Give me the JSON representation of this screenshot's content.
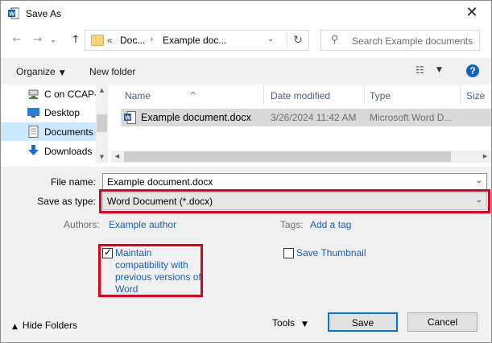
{
  "window": {
    "title": "Save As",
    "close_glyph": "✕"
  },
  "nav": {
    "back_glyph": "←",
    "forward_glyph": "→",
    "recent_glyph": "⌄",
    "up_glyph": "↑",
    "overflow": "«",
    "crumbs": [
      "Doc...",
      "Example doc..."
    ],
    "crumb_sep": "›",
    "dropdown_glyph": "⌄",
    "refresh_glyph": "↻",
    "search_placeholder": "Search Example documents"
  },
  "toolbar": {
    "organize_label": "Organize",
    "new_folder_label": "New folder",
    "help_label": "?"
  },
  "sidebar": {
    "items": [
      {
        "label": "C on CCAP-",
        "icon": "network-drive-icon"
      },
      {
        "label": "Desktop",
        "icon": "desktop-icon"
      },
      {
        "label": "Documents",
        "icon": "documents-icon",
        "selected": true
      },
      {
        "label": "Downloads",
        "icon": "downloads-icon"
      }
    ]
  },
  "files": {
    "columns": [
      "Name",
      "Date modified",
      "Type",
      "Size"
    ],
    "rows": [
      {
        "name": "Example document.docx",
        "date": "3/26/2024 11:42 AM",
        "type": "Microsoft Word D..."
      }
    ]
  },
  "form": {
    "file_name_label": "File name:",
    "file_name_value": "Example document.docx",
    "save_type_label": "Save as type:",
    "save_type_value": "Word Document (*.docx)",
    "authors_label": "Authors:",
    "authors_value": "Example author",
    "tags_label": "Tags:",
    "tags_value": "Add a tag",
    "compat_label_lines": [
      "Maintain",
      "compatibility with",
      "previous versions of",
      "Word"
    ],
    "compat_checked": true,
    "thumbnail_label": "Save Thumbnail",
    "thumbnail_checked": false
  },
  "footer": {
    "hide_folders_label": "Hide Folders",
    "tools_label": "Tools",
    "save_label": "Save",
    "cancel_label": "Cancel"
  },
  "colors": {
    "highlight_box": "#e0001b",
    "link": "#1a5fb4",
    "selection": "#cce8ff",
    "primary_button_border": "#0078d7"
  }
}
